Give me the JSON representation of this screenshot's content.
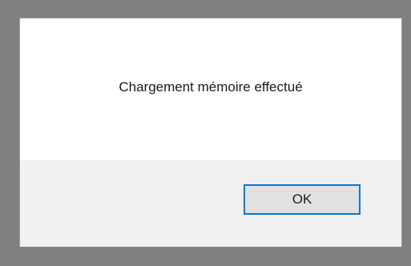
{
  "dialog": {
    "message": "Chargement mémoire effectué",
    "ok_label": "OK"
  },
  "colors": {
    "backdrop": "#808080",
    "message_background": "#ffffff",
    "button_bar_background": "#f0f0f0",
    "button_face": "#e1e1e1",
    "button_focus_border": "#0078d7"
  }
}
